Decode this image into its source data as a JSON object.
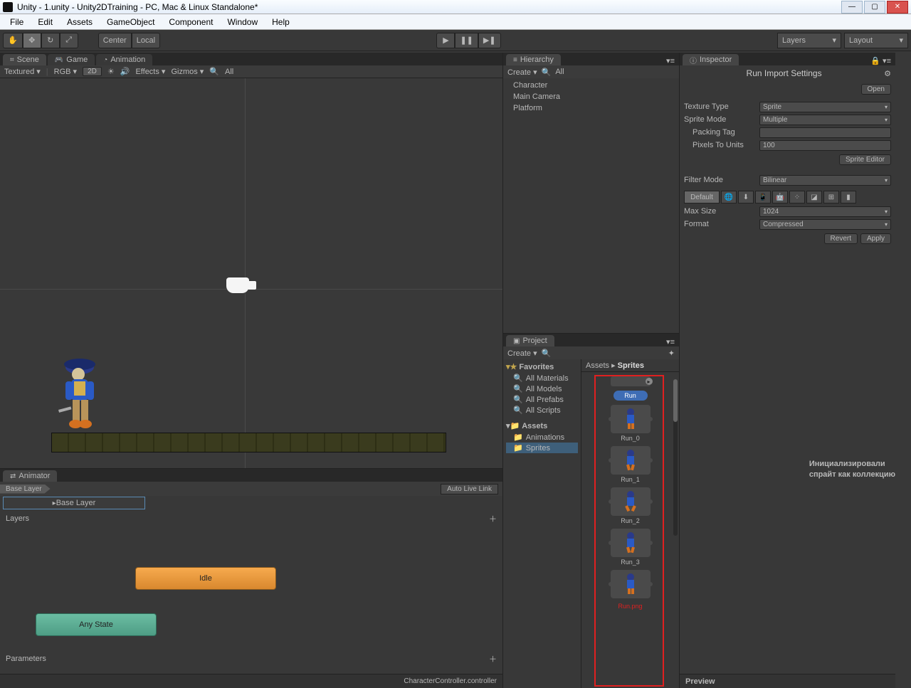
{
  "window": {
    "title": "Unity - 1.unity - Unity2DTraining - PC, Mac & Linux Standalone*"
  },
  "menu": {
    "items": [
      "File",
      "Edit",
      "Assets",
      "GameObject",
      "Component",
      "Window",
      "Help"
    ]
  },
  "toolbar": {
    "pivot": "Center",
    "space": "Local",
    "layers": "Layers",
    "layout": "Layout"
  },
  "sceneTabs": {
    "scene": "Scene",
    "game": "Game",
    "animation": "Animation"
  },
  "sceneToolbar": {
    "shading": "Textured",
    "renderMode": "RGB",
    "twoD": "2D",
    "effects": "Effects",
    "gizmos": "Gizmos",
    "search": "All"
  },
  "hierarchy": {
    "title": "Hierarchy",
    "create": "Create",
    "search": "All",
    "items": [
      "Character",
      "Main Camera",
      "Platform"
    ]
  },
  "project": {
    "title": "Project",
    "create": "Create",
    "favorites": "Favorites",
    "favItems": [
      "All Materials",
      "All Models",
      "All Prefabs",
      "All Scripts"
    ],
    "assets": "Assets",
    "folders": [
      "Animations",
      "Sprites"
    ],
    "breadcrumb": {
      "root": "Assets",
      "current": "Sprites"
    },
    "runLabel": "Run",
    "sprites": [
      "Run_0",
      "Run_1",
      "Run_2",
      "Run_3"
    ],
    "truncated": "Run.png"
  },
  "inspector": {
    "title": "Inspector",
    "assetTitle": "Run Import Settings",
    "open": "Open",
    "textureType": {
      "lbl": "Texture Type",
      "val": "Sprite"
    },
    "spriteMode": {
      "lbl": "Sprite Mode",
      "val": "Multiple"
    },
    "packingTag": {
      "lbl": "Packing Tag",
      "val": ""
    },
    "pixelsToUnits": {
      "lbl": "Pixels To Units",
      "val": "100"
    },
    "spriteEditor": "Sprite Editor",
    "filterMode": {
      "lbl": "Filter Mode",
      "val": "Bilinear"
    },
    "platformDefault": "Default",
    "maxSize": {
      "lbl": "Max Size",
      "val": "1024"
    },
    "format": {
      "lbl": "Format",
      "val": "Compressed"
    },
    "revert": "Revert",
    "apply": "Apply",
    "preview": "Preview"
  },
  "animator": {
    "tab": "Animator",
    "baseLayer": "Base Layer",
    "autoLive": "Auto Live Link",
    "layers": "Layers",
    "idle": "Idle",
    "anyState": "Any State",
    "parameters": "Parameters",
    "footer": "CharacterController.controller"
  },
  "annotation": {
    "line1": "Инициализировали",
    "line2": "спрайт как коллекцию"
  }
}
